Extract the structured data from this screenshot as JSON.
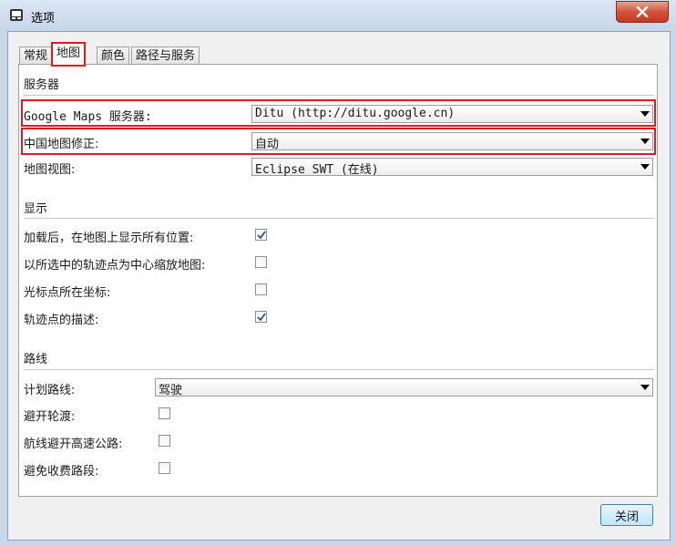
{
  "window": {
    "title": "选项",
    "close_icon": "close-icon",
    "app_icon": "options-app-icon"
  },
  "tabs": [
    {
      "label": "常规",
      "active": false
    },
    {
      "label": "地图",
      "active": true
    },
    {
      "label": "颜色",
      "active": false
    },
    {
      "label": "路径与服务",
      "active": false
    }
  ],
  "sections": {
    "service": {
      "title": "服务器",
      "google_maps_label": "Google Maps 服务器:",
      "google_maps_value": "Ditu (http://ditu.google.cn)",
      "china_fix_label": "中国地图修正:",
      "china_fix_value": "自动",
      "map_view_label": "地图视图:",
      "map_view_value": "Eclipse SWT (在线)"
    },
    "display": {
      "title": "显示",
      "items": [
        {
          "label": "加载后，在地图上显示所有位置:",
          "checked": true
        },
        {
          "label": "以所选中的轨迹点为中心缩放地图:",
          "checked": false
        },
        {
          "label": "光标点所在坐标:",
          "checked": false
        },
        {
          "label": "轨迹点的描述:",
          "checked": true
        }
      ]
    },
    "route": {
      "title": "路线",
      "plan_label": "计划路线:",
      "plan_value": "驾驶",
      "items": [
        {
          "label": "避开轮渡:",
          "checked": false
        },
        {
          "label": "航线避开高速公路:",
          "checked": false
        },
        {
          "label": "避免收费路段:",
          "checked": false
        }
      ]
    }
  },
  "footer": {
    "close_label": "关闭"
  },
  "colors": {
    "highlight": "#d81e1e",
    "check": "#2b4f8a",
    "titlebar": "#c9d7ea"
  }
}
